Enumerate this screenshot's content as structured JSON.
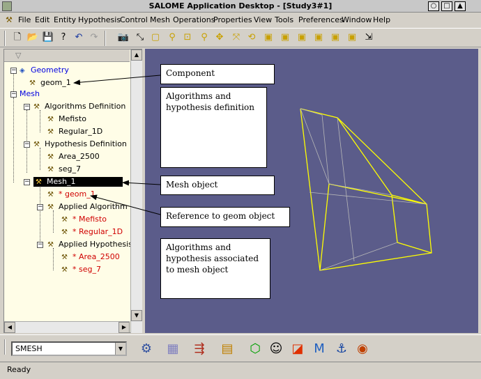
{
  "window": {
    "title": "SALOME Application Desktop - [Study3#1]",
    "buttons": [
      "○",
      "□",
      "▲"
    ]
  },
  "menu": [
    "File",
    "Edit",
    "Entity",
    "Hypothesis",
    "Control",
    "Mesh",
    "Operations",
    "Properties",
    "View",
    "Tools",
    "Preferences",
    "Window",
    "Help"
  ],
  "tree": {
    "geometry": "Geometry",
    "geom": "geom_1",
    "mesh": "Mesh",
    "algo_def": "Algorithms Definition",
    "mefisto": "Mefisto",
    "regular": "Regular_1D",
    "hyp_def": "Hypothesis Definition",
    "area": "Area_2500",
    "seg": "seg_7",
    "mesh1": "Mesh_1",
    "ref_geom": "* geom_1",
    "applied_algo": "Applied Algorithm",
    "ref_mefisto": "* Mefisto",
    "ref_regular": "* Regular_1D",
    "applied_hyp": "Applied Hypothesis",
    "ref_area": "* Area_2500",
    "ref_seg": "* seg_7"
  },
  "callouts": {
    "component": "Component",
    "algo_hyp": "Algorithms and hypothesis definition",
    "mesh_obj": "Mesh object",
    "ref_geom": "Reference to geom object",
    "assoc": "Algorithms and hypothesis associated to mesh object"
  },
  "module": {
    "selected": "SMESH"
  },
  "status": "Ready",
  "colors": {
    "viewer_bg": "#5b5c8a",
    "wireframe": "#ffff00",
    "tree_bg": "#fffde7"
  }
}
